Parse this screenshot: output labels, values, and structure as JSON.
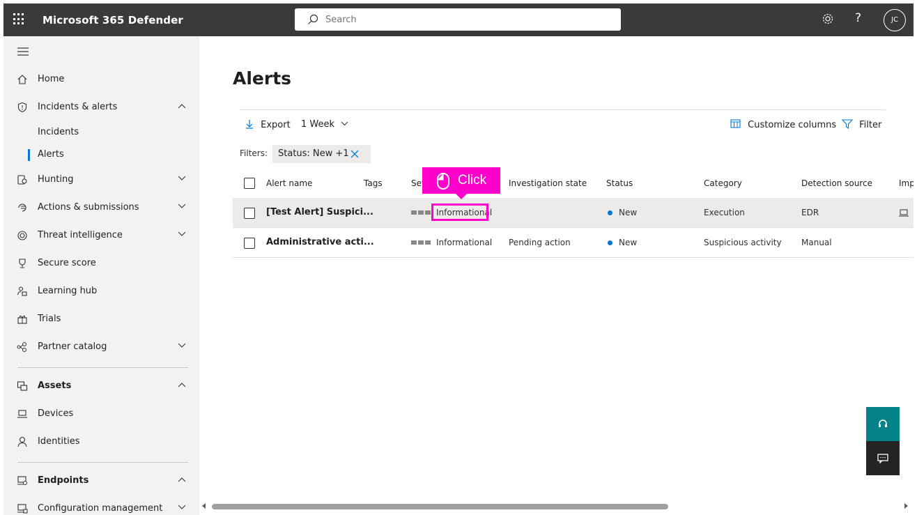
{
  "app": {
    "title": "Microsoft 365 Defender",
    "user_initials": "JC"
  },
  "search": {
    "placeholder": "Search"
  },
  "header_icons": {
    "help": "?"
  },
  "sidebar": {
    "home": "Home",
    "incidents_alerts": "Incidents & alerts",
    "incidents": "Incidents",
    "alerts": "Alerts",
    "hunting": "Hunting",
    "actions": "Actions & submissions",
    "threat_intel": "Threat intelligence",
    "secure_score": "Secure score",
    "learning_hub": "Learning hub",
    "trials": "Trials",
    "partner_catalog": "Partner catalog",
    "assets": "Assets",
    "devices": "Devices",
    "identities": "Identities",
    "endpoints": "Endpoints",
    "config_mgmt": "Configuration management"
  },
  "page": {
    "title": "Alerts"
  },
  "toolbar": {
    "export": "Export",
    "time_range": "1 Week",
    "customize_columns": "Customize columns",
    "filter": "Filter"
  },
  "filters": {
    "label": "Filters:",
    "chip": "Status: New +1"
  },
  "table": {
    "columns": {
      "alert_name": "Alert name",
      "tags": "Tags",
      "severity": "Sev",
      "investigation_state": "Investigation state",
      "status": "Status",
      "category": "Category",
      "detection_source": "Detection source",
      "impacted": "Imp"
    },
    "rows": [
      {
        "name": "[Test Alert] Suspici...",
        "tags": "",
        "severity": "Informational",
        "investigation_state": "",
        "status": "New",
        "category": "Execution",
        "detection_source": "EDR"
      },
      {
        "name": "Administrative acti...",
        "tags": "",
        "severity": "Informational",
        "investigation_state": "Pending action",
        "status": "New",
        "category": "Suspicious activity",
        "detection_source": "Manual"
      }
    ]
  },
  "annotation": {
    "label": "Click"
  },
  "colors": {
    "topbar": "#3b3a39",
    "accent": "#0078d4",
    "highlight": "#ff00cc",
    "help_button": "#038387"
  }
}
